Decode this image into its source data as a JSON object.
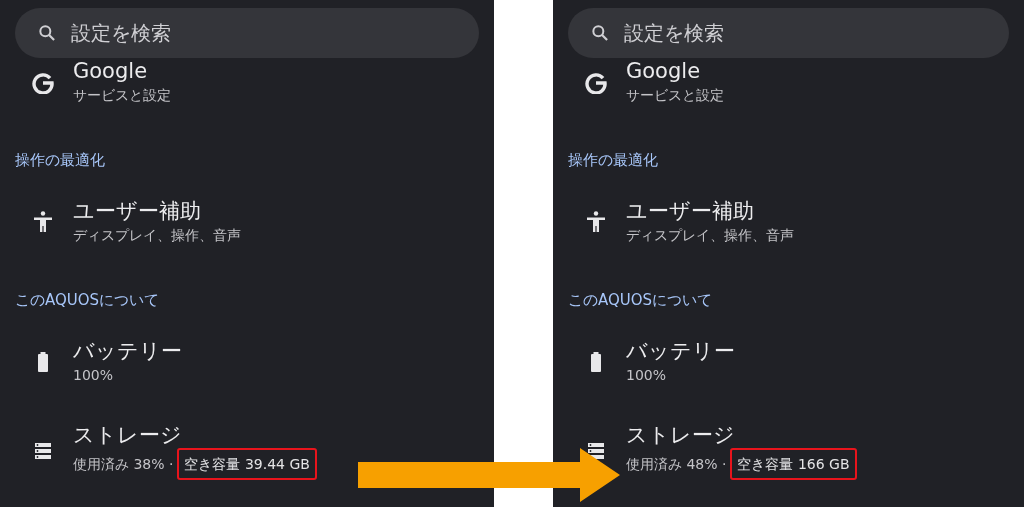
{
  "panels": [
    {
      "search": {
        "placeholder": "設定を検索"
      },
      "sections": [
        {
          "items": [
            {
              "kind": "google",
              "title": "Google",
              "subtitle": [
                {
                  "text": "サービスと設定",
                  "highlighted": false
                }
              ]
            }
          ]
        },
        {
          "header": "操作の最適化",
          "items": [
            {
              "kind": "accessibility",
              "title": "ユーザー補助",
              "subtitle": [
                {
                  "text": "ディスプレイ、操作、音声",
                  "highlighted": false
                }
              ]
            }
          ]
        },
        {
          "header": "このAQUOSについて",
          "items": [
            {
              "kind": "battery",
              "title": "バッテリー",
              "subtitle": [
                {
                  "text": "100%",
                  "highlighted": false
                }
              ]
            },
            {
              "kind": "storage",
              "title": "ストレージ",
              "subtitle": [
                {
                  "text": "使用済み 38% ·",
                  "highlighted": false
                },
                {
                  "text": "空き容量 39.44 GB",
                  "highlighted": true
                }
              ]
            }
          ]
        }
      ]
    },
    {
      "search": {
        "placeholder": "設定を検索"
      },
      "sections": [
        {
          "items": [
            {
              "kind": "google",
              "title": "Google",
              "subtitle": [
                {
                  "text": "サービスと設定",
                  "highlighted": false
                }
              ]
            }
          ]
        },
        {
          "header": "操作の最適化",
          "items": [
            {
              "kind": "accessibility",
              "title": "ユーザー補助",
              "subtitle": [
                {
                  "text": "ディスプレイ、操作、音声",
                  "highlighted": false
                }
              ]
            }
          ]
        },
        {
          "header": "このAQUOSについて",
          "items": [
            {
              "kind": "battery",
              "title": "バッテリー",
              "subtitle": [
                {
                  "text": "100%",
                  "highlighted": false
                }
              ]
            },
            {
              "kind": "storage",
              "title": "ストレージ",
              "subtitle": [
                {
                  "text": "使用済み 48% ·",
                  "highlighted": false
                },
                {
                  "text": "空き容量 166 GB",
                  "highlighted": true
                }
              ]
            }
          ]
        }
      ]
    }
  ]
}
